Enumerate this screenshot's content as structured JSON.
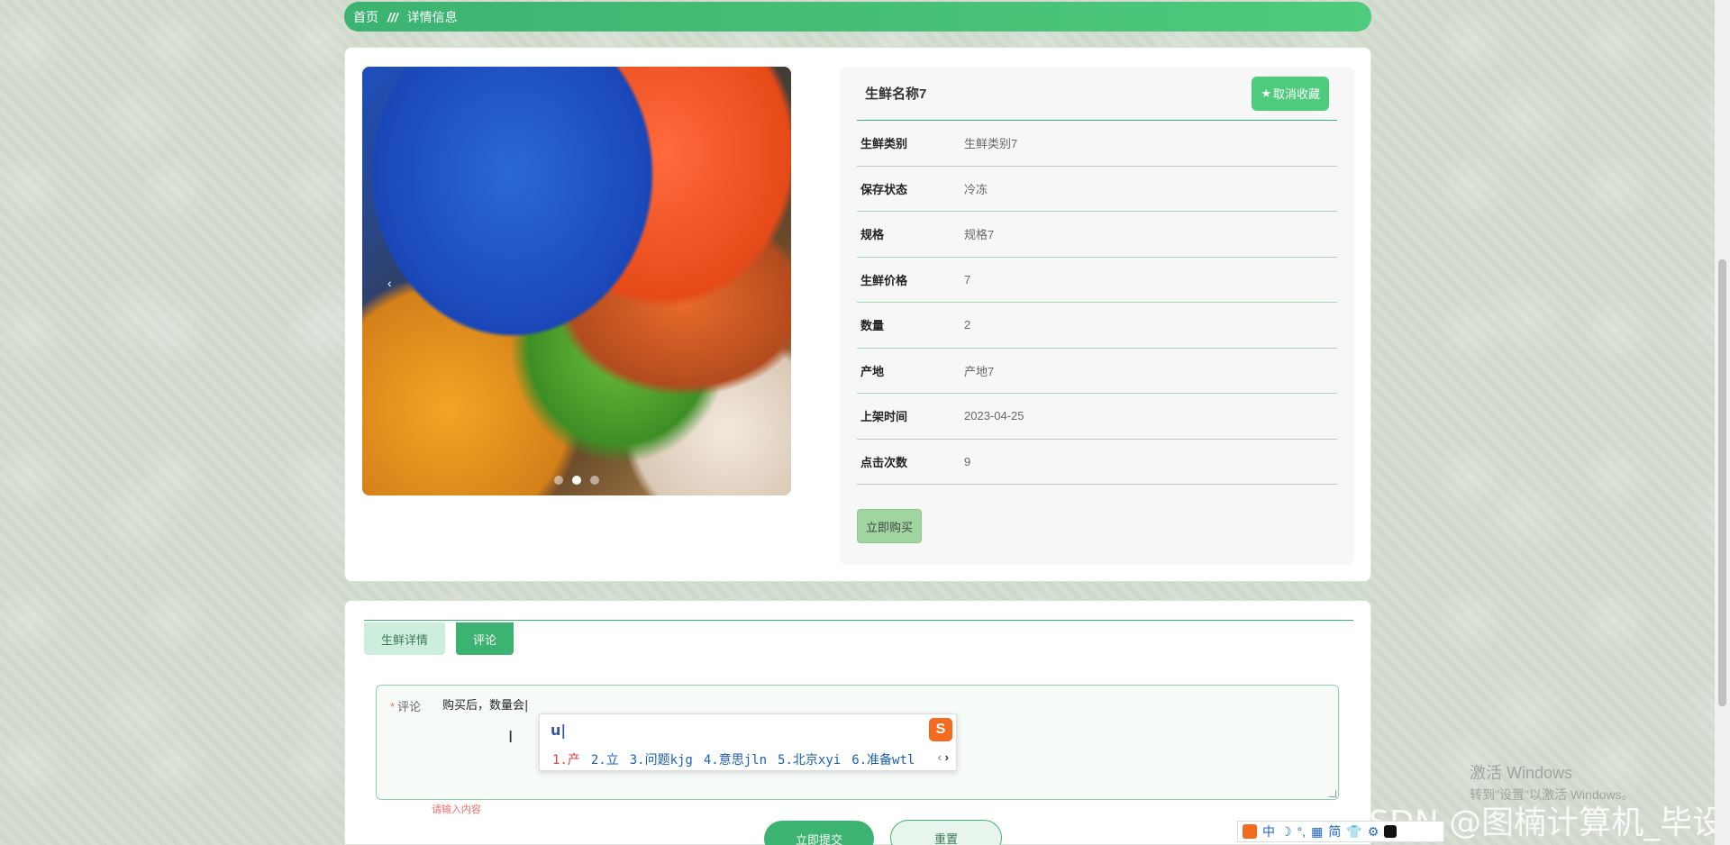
{
  "breadcrumb": {
    "home": "首页",
    "separator": "///",
    "current": "详情信息"
  },
  "product": {
    "name": "生鲜名称7",
    "fav_label": "取消收藏",
    "fav_icon": "★",
    "buy_label": "立即购买",
    "fields": [
      {
        "label": "生鲜类别",
        "value": "生鲜类别7"
      },
      {
        "label": "保存状态",
        "value": "冷冻"
      },
      {
        "label": "规格",
        "value": "规格7"
      },
      {
        "label": "生鲜价格",
        "value": "7"
      },
      {
        "label": "数量",
        "value": "2"
      },
      {
        "label": "产地",
        "value": "产地7"
      },
      {
        "label": "上架时间",
        "value": "2023-04-25"
      },
      {
        "label": "点击次数",
        "value": "9"
      }
    ]
  },
  "carousel": {
    "prev_icon": "‹",
    "active_index": 1
  },
  "tabs": [
    {
      "label": "生鲜详情",
      "active": false
    },
    {
      "label": "评论",
      "active": true
    }
  ],
  "comment_form": {
    "required_mark": "*",
    "label": "评论",
    "value": "购买后，数量会|",
    "error": "请输入内容",
    "submit_label": "立即提交",
    "reset_label": "重置"
  },
  "ime_popup": {
    "input": "u|",
    "candidates": [
      "1.产",
      "2.立",
      "3.问题kjg",
      "4.意思jln",
      "5.北京xyi",
      "6.准备wtl"
    ],
    "prev": "‹",
    "next": "›"
  },
  "ime_bar": {
    "items": [
      "中",
      "☽",
      "°,",
      "▦",
      "简",
      "👕",
      "⚙"
    ]
  },
  "windows_watermark": {
    "title": "激活 Windows",
    "subtitle": "转到\"设置\"以激活 Windows。"
  },
  "csdn_watermark": "CSDN @图楠计算机_毕设",
  "colors": {
    "primary": "#3cb371",
    "accent": "#4ecb7c",
    "error": "#f56c6c"
  }
}
